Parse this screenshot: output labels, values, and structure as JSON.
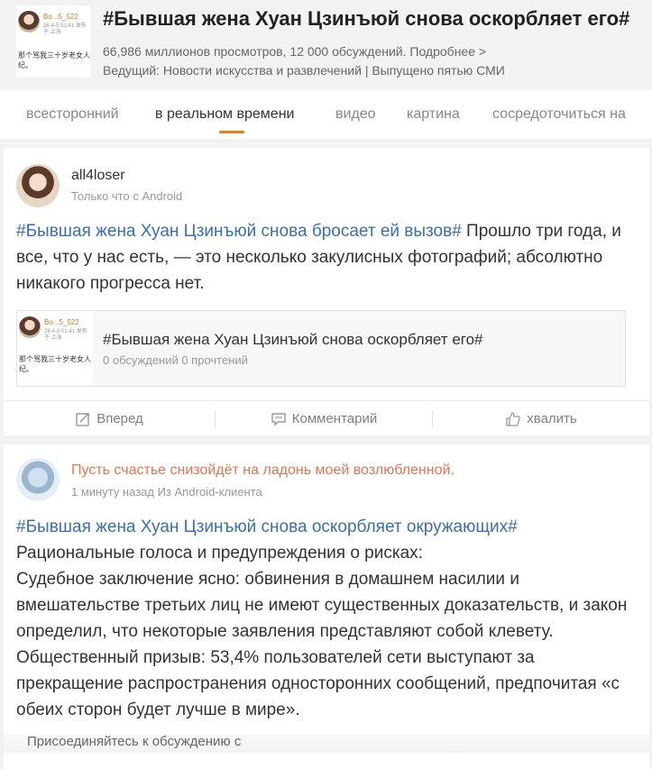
{
  "header": {
    "thumb_name": "Bo...5_522",
    "thumb_meta": "26-4-5 01:41 发布于 上海",
    "thumb_text": "那个骂我三十岁老女人纪。",
    "title": "#Бывшая жена Хуан Цзинъюй снова оскорбляет его#",
    "stats": "66,986 миллионов просмотров, 12 000 обсуждений. Подробнее >",
    "host": "Ведущий: Новости искусства и развлечений | Выпущено пятью СМИ"
  },
  "tabs": [
    {
      "label": "всесторонний"
    },
    {
      "label": "в реальном времени"
    },
    {
      "label": "видео"
    },
    {
      "label": "картина"
    },
    {
      "label": "сосредоточиться на"
    }
  ],
  "post1": {
    "author": "all4loser",
    "meta": "Только что с Android",
    "hashtag": "#Бывшая жена Хуан Цзинъюй снова бросает ей вызов#",
    "text": " Прошло три года, и все, что у нас есть, — это несколько закулисных фотографий; абсолютно никакого прогресса нет.",
    "embed": {
      "thumb_name": "Bo...5_522",
      "thumb_meta": "26-4-5 01:41 发布于 上海",
      "thumb_text": "那个骂我三十岁老女人纪。",
      "title": "#Бывшая жена Хуан Цзинъюй снова оскорбляет его#",
      "stats": "0 обсуждений 0 прочтений"
    },
    "actions": {
      "forward": "Вперед",
      "comment": "Комментарий",
      "like": "хвалить"
    }
  },
  "post2": {
    "author": "Пусть счастье снизойдёт на ладонь моей возлюбленной.",
    "meta": "1 минуту назад Из Android-клиента",
    "hashtag": "#Бывшая жена Хуан Цзинъюй снова оскорбляет окружающих#",
    "lines": [
      "Рациональные голоса и предупреждения о рисках:",
      "Судебное заключение ясно: обвинения в домашнем насилии и вмешательстве третьих лиц не имеют существенных доказательств, и закон определил, что некоторые заявления представляют собой клевету.",
      "Общественный призыв: 53,4% пользователей сети выступают за прекращение распространения односторонних сообщений, предпочитая «с обеих сторон будет лучше в мире»."
    ]
  },
  "join_bar": "Присоединяйтесь к обсуждению с"
}
